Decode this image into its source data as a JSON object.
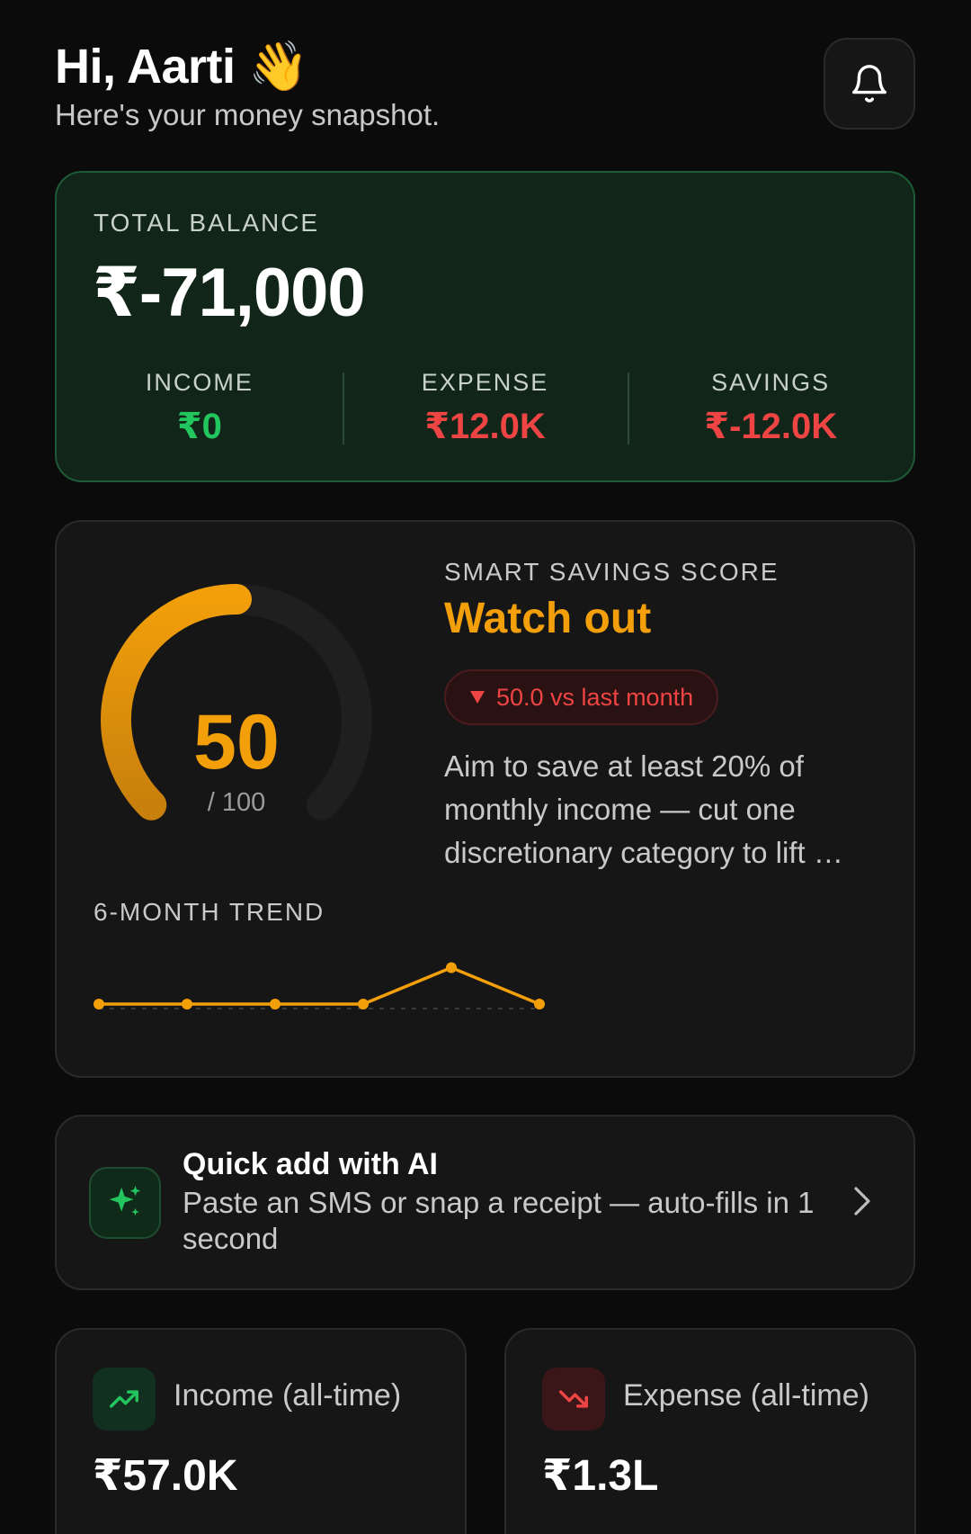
{
  "header": {
    "greeting": "Hi, Aarti 👋",
    "subtitle": "Here's your money snapshot.",
    "bell_icon": "bell-icon"
  },
  "balance": {
    "label": "TOTAL BALANCE",
    "value": "₹-71,000",
    "stats": [
      {
        "label": "INCOME",
        "value": "₹0",
        "color": "#22c55e"
      },
      {
        "label": "EXPENSE",
        "value": "₹12.0K",
        "color": "#ef4444"
      },
      {
        "label": "SAVINGS",
        "value": "₹-12.0K",
        "color": "#ef4444"
      }
    ]
  },
  "score": {
    "value": 50,
    "value_text": "50",
    "max_text": "/ 100",
    "label": "SMART SAVINGS SCORE",
    "status": "Watch out",
    "delta": "50.0 vs last month",
    "delta_icon": "triangle-down-icon",
    "tip": "Aim to save at least 20% of monthly income — cut one discretionary category to lift …",
    "accent": "#f29f0a"
  },
  "trend": {
    "label": "6-MONTH TREND",
    "chart_data": {
      "type": "line",
      "x": [
        1,
        2,
        3,
        4,
        5,
        6
      ],
      "values": [
        50,
        50,
        50,
        50,
        80,
        50
      ],
      "ylim": [
        0,
        100
      ],
      "baseline": 50,
      "grid": false
    }
  },
  "quick_add": {
    "title": "Quick add with AI",
    "subtitle": "Paste an SMS or snap a receipt — auto-fills in 1 second",
    "icon": "sparkles-icon",
    "chevron_icon": "chevron-right-icon"
  },
  "totals": {
    "income": {
      "label": "Income (all-time)",
      "value": "₹57.0K",
      "icon": "trending-up-icon",
      "color": "#22c55e"
    },
    "expense": {
      "label": "Expense (all-time)",
      "value": "₹1.3L",
      "icon": "trending-down-icon",
      "color": "#ef4444"
    }
  }
}
